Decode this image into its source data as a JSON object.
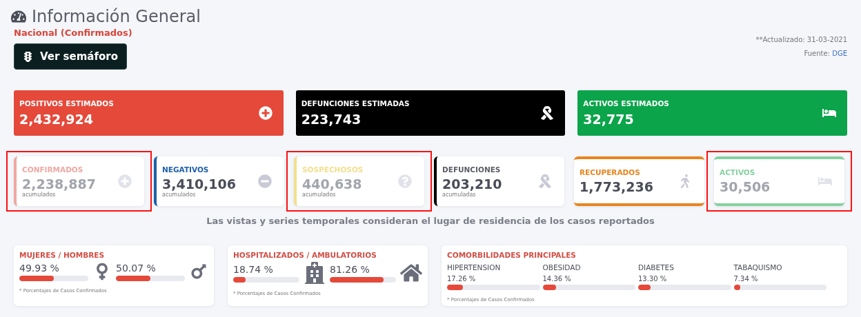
{
  "header": {
    "title": "Información General",
    "subtitle": "Nacional (Confirmados)",
    "button": "Ver semáforo",
    "updated": "**Actualizado: 31-03-2021",
    "source_label": "Fuente:",
    "source_link": "DGE"
  },
  "summary_cards": [
    {
      "label": "POSITIVOS ESTIMADOS",
      "value": "2,432,924",
      "color": "#e5493a"
    },
    {
      "label": "DEFUNCIONES ESTIMADAS",
      "value": "223,743",
      "color": "#000000"
    },
    {
      "label": "ACTIVOS ESTIMADOS",
      "value": "32,775",
      "color": "#0ba44a"
    }
  ],
  "stat_cards": [
    {
      "kind": "side",
      "label": "CONFIRMADOS",
      "value": "2,238,887",
      "note": "acumulados",
      "color": "#efa8a2",
      "dimmed": true,
      "highlighted": true
    },
    {
      "kind": "side",
      "label": "NEGATIVOS",
      "value": "3,410,106",
      "note": "acumulados",
      "color": "#1d5fa8",
      "dimmed": false,
      "highlighted": false
    },
    {
      "kind": "side",
      "label": "SOSPECHOSOS",
      "value": "440,638",
      "note": "acumulados",
      "color": "#f3de8e",
      "dimmed": true,
      "highlighted": true
    },
    {
      "kind": "side",
      "label": "DEFUNCIONES",
      "value": "203,210",
      "note": "acumuladas",
      "color": "#000000",
      "dimmed": false,
      "highlighted": false
    },
    {
      "kind": "band",
      "label": "RECUPERADOS",
      "value": "1,773,236",
      "color": "#e8851e",
      "dimmed": false,
      "highlighted": false
    },
    {
      "kind": "band",
      "label": "ACTIVOS",
      "value": "30,506",
      "color": "#86d0a0",
      "dimmed": true,
      "highlighted": true
    }
  ],
  "residence_note": "Las vistas y series temporales consideran el lugar de residencia de los casos reportados",
  "gender": {
    "title": "MUJERES / HOMBRES",
    "items": [
      {
        "value": "49.93 %",
        "level": 0.4993
      },
      {
        "value": "50.07 %",
        "level": 0.5007
      }
    ],
    "footnote": "* Porcentajes  de Casos Confirmados"
  },
  "care": {
    "title": "HOSPITALIZADOS / AMBULATORIOS",
    "items": [
      {
        "value": "18.74 %",
        "level": 0.1874
      },
      {
        "value": "81.26 %",
        "level": 0.8126
      }
    ],
    "footnote": "* Porcentajes  de Casos Confirmados"
  },
  "comorbidities": {
    "title": "COMORBILIDADES PRINCIPALES",
    "items": [
      {
        "name": "HIPERTENSION",
        "value": "17.26 %",
        "level": 0.1726
      },
      {
        "name": "OBESIDAD",
        "value": "14.36 %",
        "level": 0.1436
      },
      {
        "name": "DIABETES",
        "value": "13.30 %",
        "level": 0.133
      },
      {
        "name": "TABAQUISMO",
        "value": "7.34 %",
        "level": 0.0734
      }
    ],
    "footnote": "* Porcentajes  de Casos Confirmados"
  }
}
